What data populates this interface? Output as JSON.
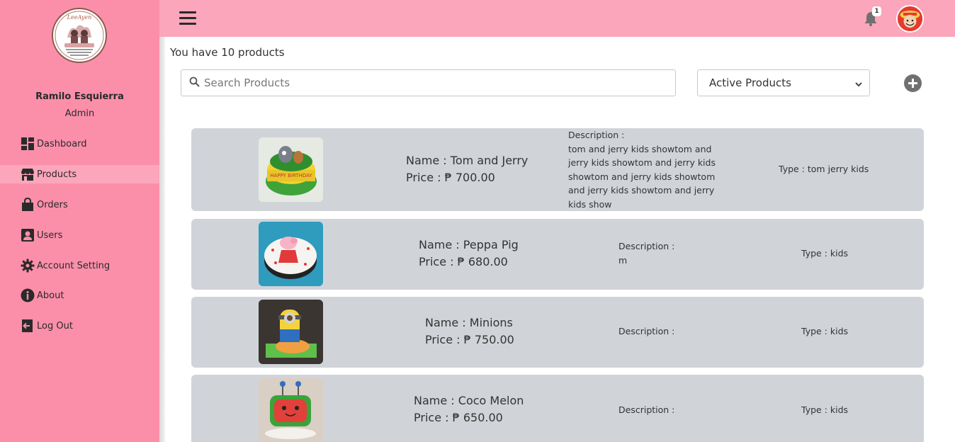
{
  "sidebar": {
    "user_name": "Ramilo Esquierra",
    "user_role": "Admin",
    "items": [
      {
        "label": "Dashboard",
        "icon": "dashboard-icon"
      },
      {
        "label": "Products",
        "icon": "store-icon"
      },
      {
        "label": "Orders",
        "icon": "shopping-bag-icon"
      },
      {
        "label": "Users",
        "icon": "user-icon"
      },
      {
        "label": "Account Setting",
        "icon": "gear-icon"
      },
      {
        "label": "About",
        "icon": "info-icon"
      },
      {
        "label": "Log Out",
        "icon": "logout-icon"
      }
    ],
    "active_item": "Products"
  },
  "topbar": {
    "notification_count": "1"
  },
  "main": {
    "count_text": "You have 10 products",
    "search_placeholder": "Search Products",
    "filter_selected": "Active Products",
    "products": [
      {
        "name": "Name : Tom and Jerry",
        "price": "Price : ₱ 700.00",
        "description_label": "Description :",
        "description_lines": [
          "tom and jerry kids showtom and",
          "jerry kids showtom and jerry kids",
          "showtom and jerry kids showtom",
          "and jerry kids showtom and jerry",
          "kids show"
        ],
        "type": "Type : tom jerry kids"
      },
      {
        "name": "Name : Peppa Pig",
        "price": "Price : ₱ 680.00",
        "description_label": "Description :",
        "description_lines": [
          "m"
        ],
        "type": "Type : kids"
      },
      {
        "name": "Name : Minions",
        "price": "Price : ₱ 750.00",
        "description_label": "Description :",
        "description_lines": [],
        "type": "Type : kids"
      },
      {
        "name": "Name : Coco Melon",
        "price": "Price : ₱ 650.00",
        "description_label": "Description :",
        "description_lines": [],
        "type": "Type : kids"
      }
    ]
  },
  "colors": {
    "sidebar_bg": "#fb8faa",
    "topbar_bg": "#fba6bb",
    "card_bg": "#d0d4d9"
  }
}
